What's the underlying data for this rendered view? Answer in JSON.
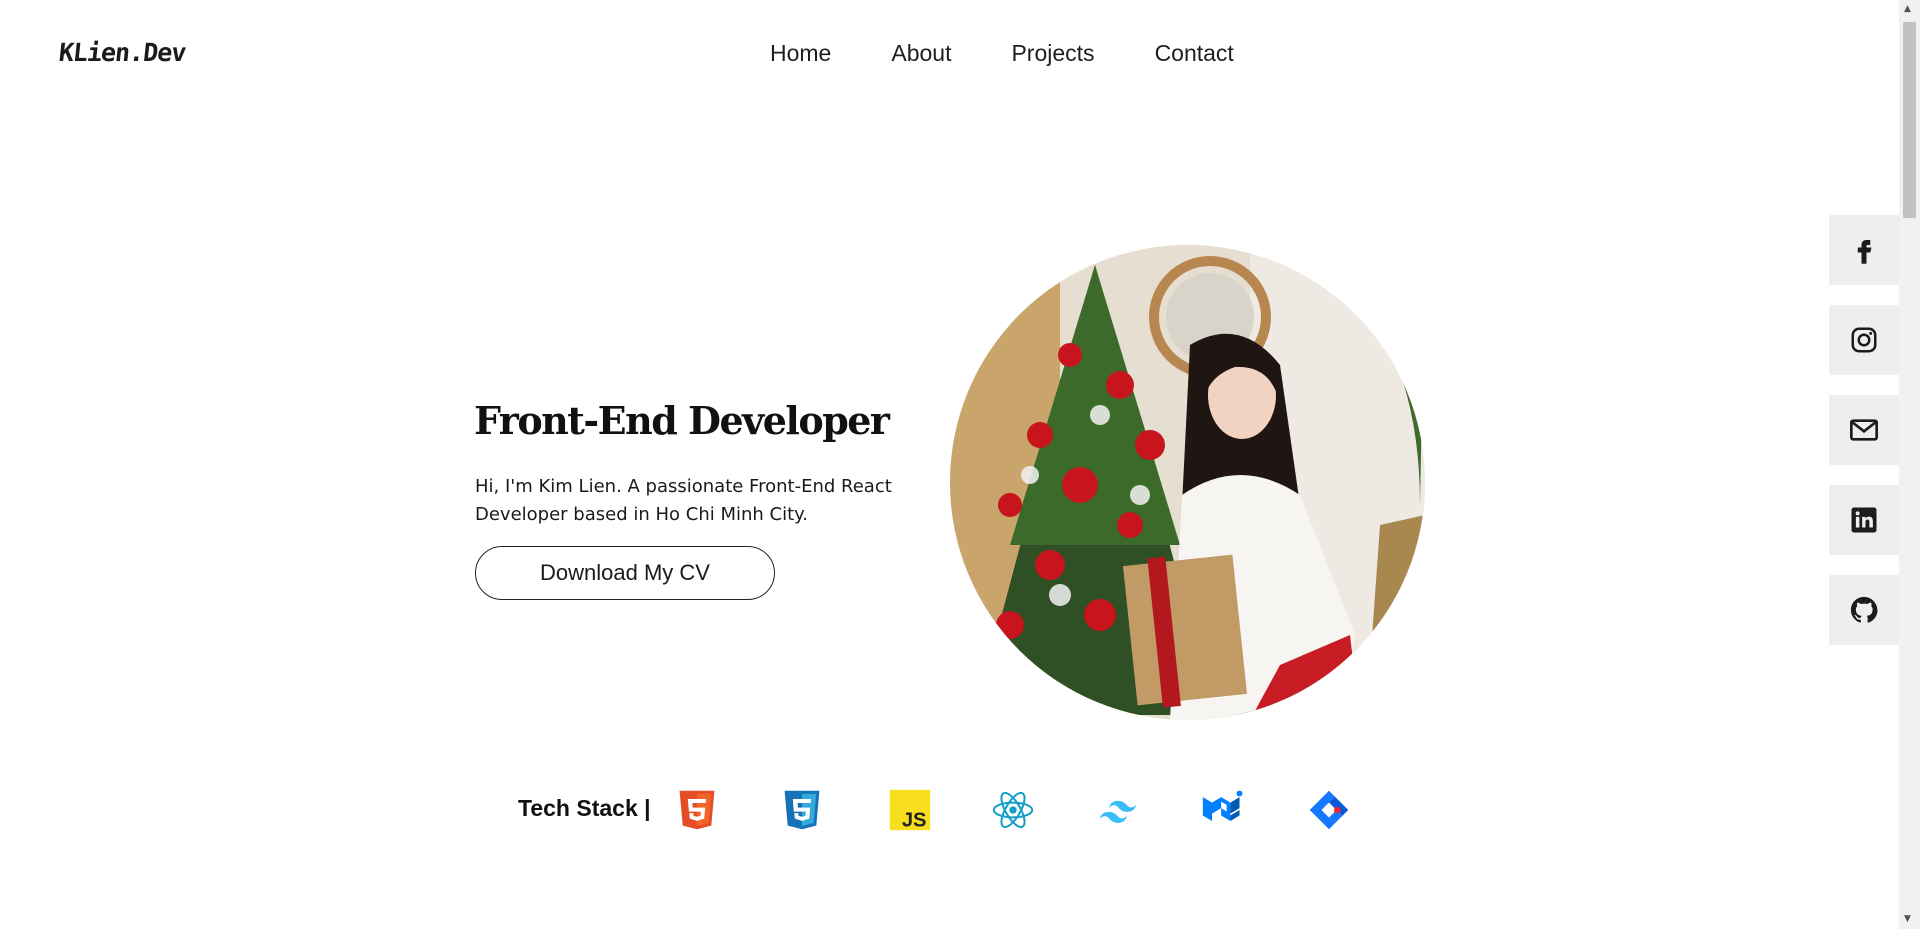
{
  "header": {
    "logo": "KLien.Dev",
    "nav": [
      "Home",
      "About",
      "Projects",
      "Contact"
    ]
  },
  "hero": {
    "title": "Front-End Developer",
    "description": "Hi, I'm Kim Lien. A passionate Front-End React Developer based in Ho Chi Minh City.",
    "cv_button": "Download My CV"
  },
  "social": [
    "facebook-icon",
    "instagram-icon",
    "mail-icon",
    "linkedin-icon",
    "github-icon"
  ],
  "tech_stack": {
    "label": "Tech Stack |",
    "icons": [
      "html5-icon",
      "css3-icon",
      "javascript-icon",
      "react-icon",
      "tailwind-icon",
      "mui-icon",
      "ant-design-icon"
    ]
  },
  "colors": {
    "html5": "#e44d26",
    "css3": "#1572b6",
    "javascript": "#f7df1e",
    "react": "#61dafb",
    "tailwind": "#38bdf8",
    "mui": "#007fff",
    "antd": "#1677ff"
  }
}
